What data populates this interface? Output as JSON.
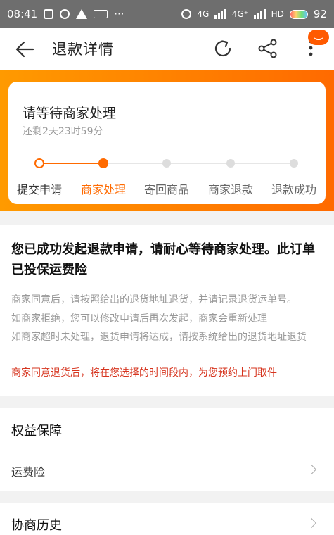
{
  "status_bar": {
    "time": "08:41",
    "signal_1": "4G",
    "signal_2": "4G⁺",
    "hd": "HD",
    "battery": "92"
  },
  "header": {
    "title": "退款详情",
    "icons": [
      "back-arrow-icon",
      "refresh-icon",
      "share-icon",
      "more-icon"
    ]
  },
  "progress": {
    "title": "请等待商家处理",
    "remaining": "还剩2天23时59分",
    "steps": [
      {
        "label": "提交申请",
        "state": "done"
      },
      {
        "label": "商家处理",
        "state": "current"
      },
      {
        "label": "寄回商品",
        "state": "pending"
      },
      {
        "label": "商家退款",
        "state": "pending"
      },
      {
        "label": "退款成功",
        "state": "pending"
      }
    ]
  },
  "info": {
    "title": "您已成功发起退款申请，请耐心等待商家处理。此订单已投保运费险",
    "lines": [
      "商家同意后，请按照给出的退货地址退货，并请记录退货运单号。",
      "如商家拒绝，您可以修改申请后再次发起，商家会重新处理",
      "如商家超时未处理，退货申请将达成，请按系统给出的退货地址退货"
    ],
    "red_note": "商家同意退货后，将在您选择的时间段内，为您预约上门取件"
  },
  "rights": {
    "title": "权益保障",
    "item_label": "运费险"
  },
  "history": {
    "title": "协商历史"
  },
  "colors": {
    "accent": "#ff6a00",
    "accent_light": "#ff9a00",
    "red_text": "#d6341e",
    "pending": "#dddddd"
  }
}
